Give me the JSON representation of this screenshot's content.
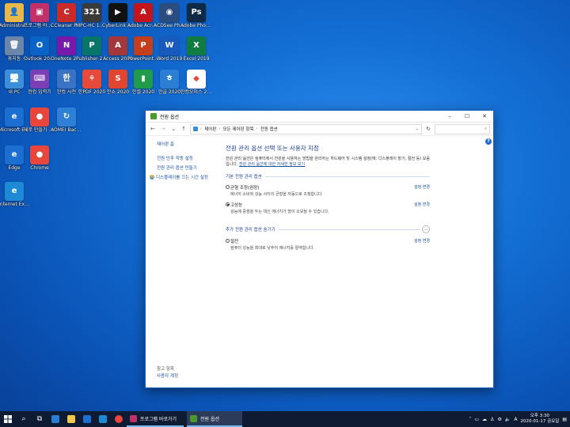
{
  "desktop_icons": [
    {
      "label": "Administra...",
      "glyph": "👤",
      "color": "#e8b84a",
      "icon": "user-folder-icon"
    },
    {
      "label": "프로그램 바로가기",
      "glyph": "▣",
      "color": "#c2306a",
      "icon": "program-shortcut-icon"
    },
    {
      "label": "CCleaner Pro 5.63",
      "glyph": "C",
      "color": "#c92b2b",
      "icon": "ccleaner-icon"
    },
    {
      "label": "MPC-HC 1.9.0",
      "glyph": "321",
      "color": "#3a3a3a",
      "icon": "mpc-hc-icon"
    },
    {
      "label": "CyberLink PowerDVD",
      "glyph": "▶",
      "color": "#111111",
      "icon": "powerdvd-icon"
    },
    {
      "label": "Adobe Acrobat DC",
      "glyph": "A",
      "color": "#c4151c",
      "icon": "acrobat-icon"
    },
    {
      "label": "ACDSee Photo Studio",
      "glyph": "◉",
      "color": "#2b4c7e",
      "icon": "acdsee-icon"
    },
    {
      "label": "Adobe Photosh...",
      "glyph": "Ps",
      "color": "#0e2a47",
      "icon": "photoshop-icon"
    },
    {
      "label": "휴지통",
      "glyph": "🗑",
      "color": "#6b86a8",
      "icon": "recycle-bin-icon"
    },
    {
      "label": "Outlook 2019",
      "glyph": "O",
      "color": "#0a63c7",
      "icon": "outlook-icon"
    },
    {
      "label": "OneNote 2019",
      "glyph": "N",
      "color": "#7719aa",
      "icon": "onenote-icon"
    },
    {
      "label": "Publisher 2019",
      "glyph": "P",
      "color": "#077568",
      "icon": "publisher-icon"
    },
    {
      "label": "Access 2019",
      "glyph": "A",
      "color": "#a4373a",
      "icon": "access-icon"
    },
    {
      "label": "PowerPoint 2019",
      "glyph": "P",
      "color": "#c43e1c",
      "icon": "powerpoint-icon"
    },
    {
      "label": "Word 2019",
      "glyph": "W",
      "color": "#185abd",
      "icon": "word-icon"
    },
    {
      "label": "Excel 2019",
      "glyph": "X",
      "color": "#107c41",
      "icon": "excel-icon"
    },
    {
      "label": "내 PC",
      "glyph": "🖥",
      "color": "#3b8fd9",
      "icon": "this-pc-icon"
    },
    {
      "label": "한컴 입력기",
      "glyph": "⌨",
      "color": "#7b3fb5",
      "icon": "hancom-input-icon"
    },
    {
      "label": "한컴 사전",
      "glyph": "한",
      "color": "#3a72c4",
      "icon": "hancom-dictionary-icon"
    },
    {
      "label": "한PDF 2020",
      "glyph": "⚘",
      "color": "#e64a3b",
      "icon": "hanpdf-icon"
    },
    {
      "label": "한쇼 2020",
      "glyph": "S",
      "color": "#e0452f",
      "icon": "hanshow-icon"
    },
    {
      "label": "한셀 2020",
      "glyph": "▮",
      "color": "#1f9b4a",
      "icon": "hancell-icon"
    },
    {
      "label": "한글 2020",
      "glyph": "ㅎ",
      "color": "#2a7fd4",
      "icon": "hangul-icon"
    },
    {
      "label": "한컴오피스 2020",
      "glyph": "◆",
      "color": "#ffffff",
      "icon": "hancom-office-icon"
    },
    {
      "label": "Microsoft Edge",
      "glyph": "e",
      "color": "#1a6fd1",
      "icon": "edge-icon"
    },
    {
      "label": "새로 만들기 설정",
      "glyph": "●",
      "color": "#e8453c",
      "icon": "chrome-settings-icon"
    },
    {
      "label": "AOMEI Backupper",
      "glyph": "↻",
      "color": "#2d7fd8",
      "icon": "aomei-icon"
    },
    {
      "label": "Edge",
      "glyph": "e",
      "color": "#1a6fd1",
      "icon": "edge-legacy-icon"
    },
    {
      "label": "Chrome",
      "glyph": "●",
      "color": "#e8453c",
      "icon": "chrome-icon"
    },
    {
      "label": "Internet Explorer",
      "glyph": "e",
      "color": "#1e8ad6",
      "icon": "internet-explorer-icon"
    }
  ],
  "window": {
    "title": "전원 옵션",
    "breadcrumb": [
      "제어판",
      "모든 제어판 항목",
      "전원 옵션"
    ],
    "search_placeholder": "",
    "sidebar": {
      "home": "제어판 홈",
      "links": [
        "전원 단추 작동 설정",
        "전원 관리 옵션 만들기",
        "디스플레이를 끄는 시간 설정"
      ],
      "see_also": "참고 항목",
      "user_accounts": "사용자 계정"
    },
    "heading": "전원 관리 옵션 선택 또는 사용자 지정",
    "description": "전원 관리 옵션은 컴퓨터에서 전원을 사용하는 방법을 관리하는 하드웨어 및 시스템 설정(예: 디스플레이 밝기, 절전 등) 모음입니다.",
    "description_link": "전원 관리 옵션에 대한 자세한 정보 보기",
    "section_default": "기본 전원 관리 옵션",
    "section_extra": "추가 전원 관리 옵션 숨기기",
    "change_label": "설정 변경",
    "plans": [
      {
        "name": "균형 조정(권장)",
        "desc": "에너지 소비와 성능 사이의 균형을 자동으로 조정합니다.",
        "selected": false
      },
      {
        "name": "고성능",
        "desc": "성능에 중점을 두는 대신 에너지가 많이 소모될 수 있습니다.",
        "selected": true
      }
    ],
    "extra_plans": [
      {
        "name": "절전",
        "desc": "컴퓨터 성능을 최대로 낮추어 에너지를 절약합니다.",
        "selected": false
      }
    ]
  },
  "taskbar": {
    "items": [
      {
        "label": "프로그램 바로가기",
        "color": "#c2306a",
        "state": "open"
      },
      {
        "label": "전원 옵션",
        "color": "#4a9a2c",
        "state": "active"
      }
    ],
    "ime": "A",
    "time": "오후 3:30",
    "date": "2020-01-17 금요일"
  }
}
